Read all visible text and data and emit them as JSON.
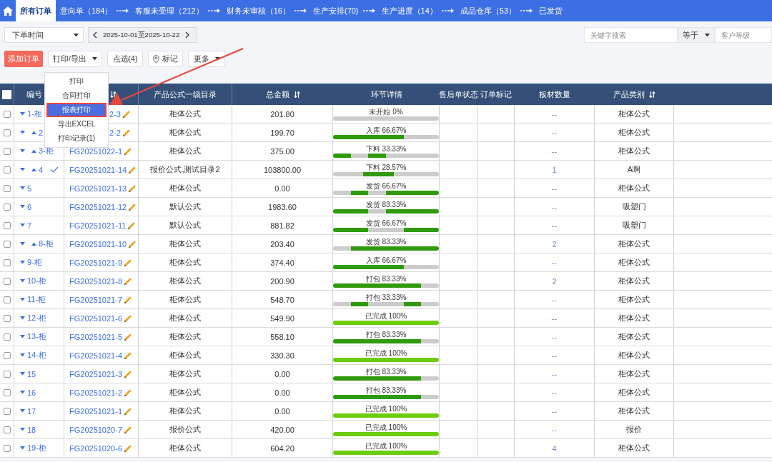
{
  "nav": {
    "tabs": [
      {
        "label": "所有订单",
        "selected": true,
        "arrow_before": false
      },
      {
        "label": "意向单（184）",
        "selected": false,
        "arrow_before": false
      },
      {
        "label": "客服未受理（212）",
        "selected": false,
        "arrow_before": true
      },
      {
        "label": "财务未审核（16）",
        "selected": false,
        "arrow_before": true
      },
      {
        "label": "生产安排(70)",
        "selected": false,
        "arrow_before": true
      },
      {
        "label": "生产进度（14）",
        "selected": false,
        "arrow_before": true
      },
      {
        "label": "成品仓库（53）",
        "selected": false,
        "arrow_before": true
      },
      {
        "label": "已发货",
        "selected": false,
        "arrow_before": true
      }
    ]
  },
  "filters": {
    "date_field": {
      "value": "下单时间"
    },
    "date_range": {
      "value": "2025-10-01至2025-10-22"
    },
    "keyword_search": {
      "placeholder": "关键字搜索"
    },
    "operator": {
      "value": "等于"
    },
    "customer_level": {
      "placeholder": "客户等级"
    }
  },
  "actions": [
    {
      "label": "添加订单",
      "kind": "primary"
    },
    {
      "label": "打印/导出",
      "kind": "dropdown"
    },
    {
      "label": "点选(4)",
      "kind": "plain"
    },
    {
      "label": "标记",
      "kind": "pin"
    },
    {
      "label": "更多",
      "kind": "dropdown"
    }
  ],
  "print_menu": {
    "items": [
      {
        "label": "打印",
        "selected": false
      },
      {
        "label": "合同打印",
        "selected": false
      },
      {
        "label": "报表打印",
        "selected": true
      },
      {
        "label": "导出EXCEL",
        "selected": false
      },
      {
        "label": "打印记录(1)",
        "selected": false
      }
    ]
  },
  "table": {
    "select_all": {
      "checked": false
    },
    "columns": [
      {
        "label": "编号",
        "sortable": false
      },
      {
        "sortable": true
      },
      {
        "label": "产品公式一级目录",
        "sortable": false
      },
      {
        "label": "总金额",
        "sortable": true
      },
      {
        "label": "环节详情",
        "sortable": false
      },
      {
        "label": "售后单状态",
        "sortable": false
      },
      {
        "label": "订单标记",
        "sortable": false
      },
      {
        "label": "板材数量",
        "sortable": false
      },
      {
        "label": "产品类别",
        "sortable": true
      }
    ],
    "rows": [
      {
        "checked": false,
        "up_caret": false,
        "verified": false,
        "number": "1-柜",
        "order_no": "2-3",
        "formula": "柜体公式",
        "amount": "201.80",
        "progress": {
          "label": "未开始 0%",
          "segments": [
            false,
            false,
            false,
            false,
            false,
            false
          ]
        },
        "boards": "--",
        "category": "柜体公式"
      },
      {
        "checked": false,
        "up_caret": true,
        "verified": false,
        "number": "2",
        "order_no": "2-2",
        "formula": "柜体公式",
        "amount": "199.70",
        "progress": {
          "label": "入库 66.67%",
          "segments": [
            true,
            true,
            true,
            true,
            false,
            false
          ]
        },
        "boards": "--",
        "category": "柜体公式"
      },
      {
        "checked": false,
        "up_caret": true,
        "verified": false,
        "number": "3-柜",
        "order_no": "FG20251022-1",
        "formula": "柜体公式",
        "amount": "375.00",
        "progress": {
          "label": "下料 33.33%",
          "segments": [
            true,
            false,
            true,
            false,
            false,
            false
          ]
        },
        "boards": "--",
        "category": "柜体公式"
      },
      {
        "checked": false,
        "up_caret": true,
        "verified": true,
        "number": "4",
        "order_no": "FG20251021-14",
        "formula": "报价公式,测试目录2",
        "amount": "103800.00",
        "progress": {
          "label": "下料 28.57%",
          "segments": [
            false,
            false,
            true,
            true,
            false,
            false,
            false
          ]
        },
        "boards": "1",
        "category": "A啊"
      },
      {
        "checked": false,
        "up_caret": false,
        "verified": false,
        "number": "5",
        "order_no": "FG20251021-13",
        "formula": "柜体公式",
        "amount": "0.00",
        "progress": {
          "label": "发货 66.67%",
          "segments": [
            false,
            true,
            false,
            true,
            true,
            true
          ]
        },
        "boards": "--",
        "category": "柜体公式"
      },
      {
        "checked": false,
        "up_caret": false,
        "verified": false,
        "number": "6",
        "order_no": "FG20251021-12",
        "formula": "默认公式",
        "amount": "1983.60",
        "progress": {
          "label": "发货 83.33%",
          "segments": [
            true,
            true,
            false,
            true,
            true,
            true
          ]
        },
        "boards": "--",
        "category": "吸塑门"
      },
      {
        "checked": false,
        "up_caret": false,
        "verified": false,
        "number": "7",
        "order_no": "FG20251021-11",
        "formula": "默认公式",
        "amount": "881.82",
        "progress": {
          "label": "发货 66.67%",
          "segments": [
            true,
            true,
            false,
            false,
            true,
            true
          ]
        },
        "boards": "--",
        "category": "吸塑门"
      },
      {
        "checked": false,
        "up_caret": true,
        "verified": false,
        "number": "8-柜",
        "order_no": "FG20251021-10",
        "formula": "柜体公式",
        "amount": "203.40",
        "progress": {
          "label": "发货 83.33%",
          "segments": [
            false,
            true,
            true,
            true,
            true,
            true
          ]
        },
        "boards": "2",
        "category": "柜体公式"
      },
      {
        "checked": false,
        "up_caret": false,
        "verified": false,
        "number": "9-柜",
        "order_no": "FG20251021-9",
        "formula": "柜体公式",
        "amount": "374.40",
        "progress": {
          "label": "入库 66.67%",
          "segments": [
            true,
            true,
            true,
            true,
            false,
            false
          ]
        },
        "boards": "--",
        "category": "柜体公式"
      },
      {
        "checked": false,
        "up_caret": false,
        "verified": false,
        "number": "10-柜",
        "order_no": "FG20251021-8",
        "formula": "柜体公式",
        "amount": "200.90",
        "progress": {
          "label": "打包 83.33%",
          "segments": [
            true,
            true,
            true,
            true,
            true,
            false
          ]
        },
        "boards": "2",
        "category": "柜体公式"
      },
      {
        "checked": false,
        "up_caret": false,
        "verified": false,
        "number": "11-柜",
        "order_no": "FG20251021-7",
        "formula": "柜体公式",
        "amount": "548.70",
        "progress": {
          "label": "打包 33.33%",
          "segments": [
            false,
            true,
            false,
            false,
            true,
            false
          ]
        },
        "boards": "--",
        "category": "柜体公式"
      },
      {
        "checked": false,
        "up_caret": false,
        "verified": false,
        "number": "12-柜",
        "order_no": "FG20251021-6",
        "formula": "柜体公式",
        "amount": "549.90",
        "progress": {
          "label": "已完成 100%",
          "segments": [
            true,
            true,
            true,
            true,
            true,
            true
          ]
        },
        "boards": "--",
        "category": "柜体公式"
      },
      {
        "checked": false,
        "up_caret": false,
        "verified": false,
        "number": "13-柜",
        "order_no": "FG20251021-5",
        "formula": "柜体公式",
        "amount": "558.10",
        "progress": {
          "label": "打包 83.33%",
          "segments": [
            true,
            true,
            true,
            true,
            true,
            false
          ]
        },
        "boards": "--",
        "category": "柜体公式"
      },
      {
        "checked": false,
        "up_caret": false,
        "verified": false,
        "number": "14-柜",
        "order_no": "FG20251021-4",
        "formula": "柜体公式",
        "amount": "330.30",
        "progress": {
          "label": "已完成 100%",
          "segments": [
            true,
            true,
            true,
            true,
            true,
            true
          ]
        },
        "boards": "--",
        "category": "柜体公式"
      },
      {
        "checked": false,
        "up_caret": false,
        "verified": false,
        "number": "15",
        "order_no": "FG20251021-3",
        "formula": "柜体公式",
        "amount": "0.00",
        "progress": {
          "label": "打包 83.33%",
          "segments": [
            true,
            true,
            true,
            true,
            true,
            false
          ]
        },
        "boards": "--",
        "category": "柜体公式"
      },
      {
        "checked": false,
        "up_caret": false,
        "verified": false,
        "number": "16",
        "order_no": "FG20251021-2",
        "formula": "柜体公式",
        "amount": "0.00",
        "progress": {
          "label": "打包 83.33%",
          "segments": [
            true,
            true,
            true,
            true,
            true,
            false
          ]
        },
        "boards": "--",
        "category": "柜体公式"
      },
      {
        "checked": false,
        "up_caret": false,
        "verified": false,
        "number": "17",
        "order_no": "FG20251021-1",
        "formula": "柜体公式",
        "amount": "0.00",
        "progress": {
          "label": "已完成 100%",
          "segments": [
            true,
            true,
            true,
            true,
            true,
            true
          ]
        },
        "boards": "--",
        "category": "柜体公式"
      },
      {
        "checked": false,
        "up_caret": false,
        "verified": false,
        "number": "18",
        "order_no": "FG20251020-7",
        "formula": "报价公式",
        "amount": "420.00",
        "progress": {
          "label": "已完成 100%",
          "segments": [
            true,
            true,
            true,
            true,
            true,
            true
          ]
        },
        "boards": "--",
        "category": "报价"
      },
      {
        "checked": false,
        "up_caret": false,
        "verified": false,
        "number": "19-柜",
        "order_no": "FG20251020-6",
        "formula": "柜体公式",
        "amount": "604.20",
        "progress": {
          "label": "已完成 100%",
          "segments": [
            true,
            true,
            true,
            true,
            true,
            true
          ]
        },
        "boards": "4",
        "category": "柜体公式"
      }
    ]
  }
}
